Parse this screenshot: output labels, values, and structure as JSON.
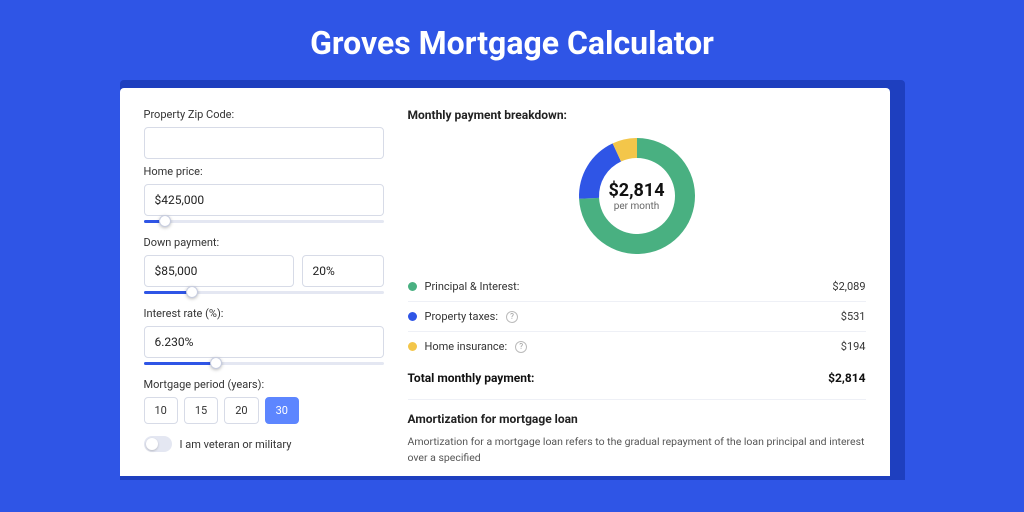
{
  "title": "Groves Mortgage Calculator",
  "colors": {
    "principal": "#49b081",
    "taxes": "#2f55e6",
    "insurance": "#f3c64a"
  },
  "left": {
    "zip_label": "Property Zip Code:",
    "zip_value": "",
    "home_price_label": "Home price:",
    "home_price_value": "$425,000",
    "home_price_slider_pct": 9,
    "down_label": "Down payment:",
    "down_value": "$85,000",
    "down_pct_value": "20%",
    "down_slider_pct": 20,
    "rate_label": "Interest rate (%):",
    "rate_value": "6.230%",
    "rate_slider_pct": 30,
    "period_label": "Mortgage period (years):",
    "periods": [
      "10",
      "15",
      "20",
      "30"
    ],
    "period_active": "30",
    "veteran_label": "I am veteran or military"
  },
  "right": {
    "breakdown_title": "Monthly payment breakdown:",
    "donut_value": "$2,814",
    "donut_sub": "per month",
    "items": [
      {
        "label": "Principal & Interest:",
        "value": "$2,089",
        "color": "g",
        "info": false
      },
      {
        "label": "Property taxes:",
        "value": "$531",
        "color": "b",
        "info": true
      },
      {
        "label": "Home insurance:",
        "value": "$194",
        "color": "y",
        "info": true
      }
    ],
    "total_label": "Total monthly payment:",
    "total_value": "$2,814",
    "amort_title": "Amortization for mortgage loan",
    "amort_text": "Amortization for a mortgage loan refers to the gradual repayment of the loan principal and interest over a specified"
  },
  "chart_data": {
    "type": "pie",
    "title": "Monthly payment breakdown",
    "series": [
      {
        "name": "Principal & Interest",
        "value": 2089,
        "color": "#49b081"
      },
      {
        "name": "Property taxes",
        "value": 531,
        "color": "#2f55e6"
      },
      {
        "name": "Home insurance",
        "value": 194,
        "color": "#f3c64a"
      }
    ],
    "total": 2814
  }
}
